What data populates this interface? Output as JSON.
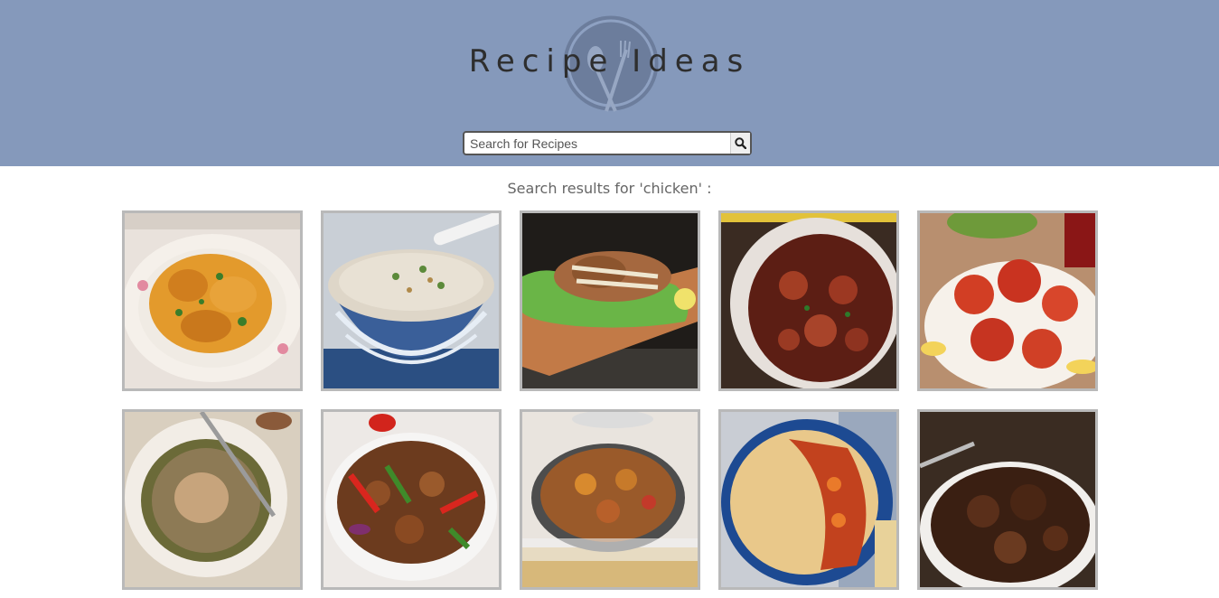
{
  "header": {
    "title": "Recipe Ideas",
    "background": "#8599bb",
    "logo_icon": "plate-spoon-fork-icon"
  },
  "search": {
    "placeholder": "Search for Recipes",
    "value": "",
    "button_icon": "search-icon"
  },
  "results": {
    "heading": "Search results for 'chicken' :",
    "query": "chicken",
    "cards": [
      {
        "image": "recipe-photo"
      },
      {
        "image": "recipe-photo"
      },
      {
        "image": "recipe-photo"
      },
      {
        "image": "recipe-photo"
      },
      {
        "image": "recipe-photo"
      },
      {
        "image": "recipe-photo"
      },
      {
        "image": "recipe-photo"
      },
      {
        "image": "recipe-photo"
      },
      {
        "image": "recipe-photo"
      },
      {
        "image": "recipe-photo"
      }
    ]
  }
}
